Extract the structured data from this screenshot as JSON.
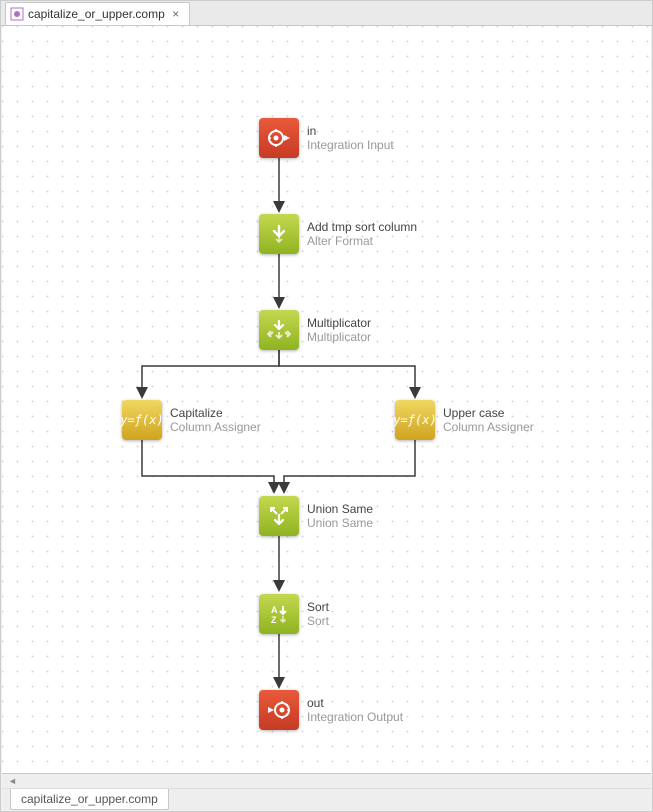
{
  "tab": {
    "title": "capitalize_or_upper.comp",
    "close_glyph": "×"
  },
  "nodes": {
    "in": {
      "title": "in",
      "subtitle": "Integration Input"
    },
    "add_tmp": {
      "title": "Add tmp sort column",
      "subtitle": "Alter Format"
    },
    "mult": {
      "title": "Multiplicator",
      "subtitle": "Multiplicator"
    },
    "cap": {
      "title": "Capitalize",
      "subtitle": "Column Assigner"
    },
    "upper": {
      "title": "Upper case",
      "subtitle": "Column Assigner"
    },
    "union": {
      "title": "Union Same",
      "subtitle": "Union Same"
    },
    "sort": {
      "title": "Sort",
      "subtitle": "Sort"
    },
    "out": {
      "title": "out",
      "subtitle": "Integration Output"
    }
  },
  "bottom_tab": "capitalize_or_upper.comp",
  "scroll_glyph": "◄"
}
